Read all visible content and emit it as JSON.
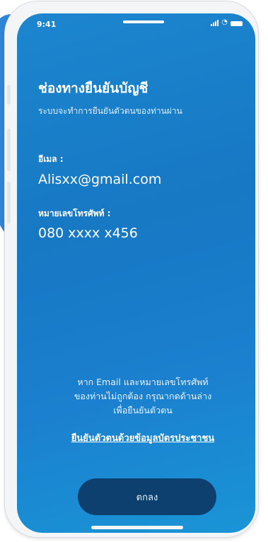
{
  "status_bar": {
    "time": "9:41",
    "icons": [
      "signal-icon",
      "wifi-icon",
      "battery-icon"
    ]
  },
  "screen": {
    "title": "ช่องทางยืนยันบัญชี",
    "subtitle": "ระบบจะทำการยืนยันตัวตนของท่านผ่าน",
    "email_label": "อีเมล :",
    "email_value": "Alisxx@gmail.com",
    "phone_label": "หมายเลขโทรศัพท์ :",
    "phone_value": "080 xxxx x456",
    "note_lines": [
      "หาก Email และหมายเลขโทรศัพท์",
      "ของท่านไม่ถูกต้อง กรุณากดด้านล่าง",
      "เพื่อยืนยันตัวตน"
    ],
    "id_card_link": "ยืนยันตัวตนด้วยข้อมูลบัตรประชาชน",
    "ok_button": "ตกลง"
  },
  "colors": {
    "screen_gradient_top": "#1c86cf",
    "screen_gradient_bottom": "#1a95d6",
    "button_bg": "#0d3f6f",
    "phone_frame": "#f4f5f7"
  }
}
